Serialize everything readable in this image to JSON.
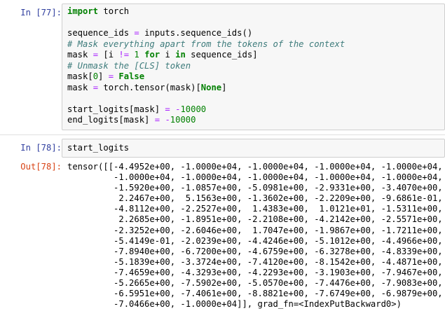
{
  "cells": [
    {
      "prompt": "In [77]:",
      "lines": [
        [
          {
            "t": "import",
            "c": "kw"
          },
          {
            "t": " torch",
            "c": "nm"
          }
        ],
        [],
        [
          {
            "t": "sequence_ids ",
            "c": "nm"
          },
          {
            "t": "=",
            "c": "op"
          },
          {
            "t": " inputs.sequence_ids()",
            "c": "nm"
          }
        ],
        [
          {
            "t": "# Mask everything apart from the tokens of the context",
            "c": "cm"
          }
        ],
        [
          {
            "t": "mask ",
            "c": "nm"
          },
          {
            "t": "=",
            "c": "op"
          },
          {
            "t": " [i ",
            "c": "nm"
          },
          {
            "t": "!=",
            "c": "op"
          },
          {
            "t": " ",
            "c": "nm"
          },
          {
            "t": "1",
            "c": "num"
          },
          {
            "t": " ",
            "c": "nm"
          },
          {
            "t": "for",
            "c": "kw"
          },
          {
            "t": " i ",
            "c": "nm"
          },
          {
            "t": "in",
            "c": "kw"
          },
          {
            "t": " sequence_ids]",
            "c": "nm"
          }
        ],
        [
          {
            "t": "# Unmask the [CLS] token",
            "c": "cm"
          }
        ],
        [
          {
            "t": "mask[",
            "c": "nm"
          },
          {
            "t": "0",
            "c": "num"
          },
          {
            "t": "] ",
            "c": "nm"
          },
          {
            "t": "=",
            "c": "op"
          },
          {
            "t": " ",
            "c": "nm"
          },
          {
            "t": "False",
            "c": "bool"
          }
        ],
        [
          {
            "t": "mask ",
            "c": "nm"
          },
          {
            "t": "=",
            "c": "op"
          },
          {
            "t": " torch.tensor(mask)[",
            "c": "nm"
          },
          {
            "t": "None",
            "c": "bool"
          },
          {
            "t": "]",
            "c": "nm"
          }
        ],
        [],
        [
          {
            "t": "start_logits[mask] ",
            "c": "nm"
          },
          {
            "t": "=",
            "c": "op"
          },
          {
            "t": " ",
            "c": "nm"
          },
          {
            "t": "-",
            "c": "op"
          },
          {
            "t": "10000",
            "c": "num"
          }
        ],
        [
          {
            "t": "end_logits[mask] ",
            "c": "nm"
          },
          {
            "t": "=",
            "c": "op"
          },
          {
            "t": " ",
            "c": "nm"
          },
          {
            "t": "-",
            "c": "op"
          },
          {
            "t": "10000",
            "c": "num"
          }
        ]
      ]
    },
    {
      "prompt": "In [78]:",
      "lines": [
        [
          {
            "t": "start_logits",
            "c": "nm"
          }
        ]
      ]
    }
  ],
  "output": {
    "prompt": "Out[78]:",
    "lines": [
      "tensor([[-4.4952e+00, -1.0000e+04, -1.0000e+04, -1.0000e+04, -1.0000e+04,",
      "         -1.0000e+04, -1.0000e+04, -1.0000e+04, -1.0000e+04, -1.0000e+04,",
      "         -1.5920e+00, -1.0857e+00, -5.0981e+00, -2.9331e+00, -3.4070e+00,",
      "          2.2467e+00,  5.1563e+00, -1.3602e+00, -2.2209e+00, -9.6861e-01,",
      "         -4.8112e+00, -2.2527e+00,  1.4383e+00,  1.0121e+01, -1.5311e+00,",
      "          2.2685e+00, -1.8951e+00, -2.2108e+00, -4.2142e+00, -2.5571e+00,",
      "         -2.3252e+00, -2.6046e+00,  1.7047e+00, -1.9867e+00, -1.7211e+00,",
      "         -5.4149e-01, -2.0239e+00, -4.4246e+00, -5.1012e+00, -4.4966e+00,",
      "         -7.8940e+00, -6.7200e+00, -4.6759e+00, -6.3278e+00, -4.8339e+00,",
      "         -5.1839e+00, -3.3724e+00, -7.4120e+00, -8.1542e+00, -4.4871e+00,",
      "         -7.4659e+00, -4.3293e+00, -4.2293e+00, -3.1903e+00, -7.9467e+00,",
      "         -5.2665e+00, -7.5902e+00, -5.0570e+00, -7.4476e+00, -7.9083e+00,",
      "         -6.5951e+00, -7.4061e+00, -8.8821e+00, -7.6749e+00, -6.9879e+00,",
      "         -7.0466e+00, -1.0000e+04]], grad_fn=<IndexPutBackward0>)"
    ]
  }
}
